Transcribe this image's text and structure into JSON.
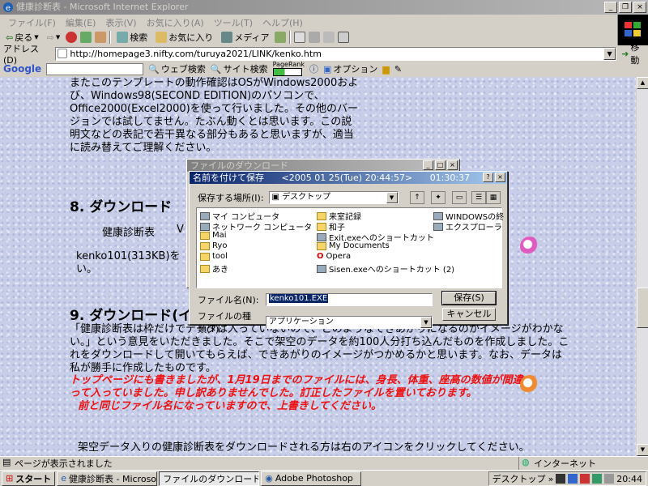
{
  "window": {
    "title": "健康診断表 - Microsoft Internet Explorer",
    "minimize": "_",
    "restore": "❐",
    "close": "×"
  },
  "menu": [
    "ファイル(F)",
    "編集(E)",
    "表示(V)",
    "お気に入り(A)",
    "ツール(T)",
    "ヘルプ(H)"
  ],
  "toolbar": {
    "back": "戻る",
    "search": "検索",
    "favorites": "お気に入り",
    "media": "メディア"
  },
  "address": {
    "label": "アドレス(D)",
    "url": "http://homepage3.nifty.com/turuya2021/LINK/kenko.htm",
    "go": "移動"
  },
  "google": {
    "logo": "Google",
    "web_search": "ウェブ検索",
    "site_search": "サイト検索",
    "pagerank": "PageRank",
    "options": "オプション"
  },
  "page": {
    "para1": "またこのテンプレートの動作確認はOSがWindows2000および、Windows98(SECOND EDITION)のパソコンで、Office2000(Excel2000)を使って行いました。その他のバージョンでは試してません。たぶん動くとは思います。この説明文などの表記で若干異なる部分もあると思いますが、適当に読み替えてご理解ください。",
    "heading8": "8. ダウンロード",
    "kenko_label": "健康診断表",
    "kenko_v": "V",
    "kenko_file": "kenko101(313KB)を",
    "kenko_file_tail": "い。",
    "heading9": "9. ダウンロード(イ",
    "para2": "「健康診断表は枠だけでデータは入っていないので、どのようなできあがりになるのかイメージがわかない。」という意見をいただきました。そこで架空のデータを約100人分打ち込んだものを作成しました。これをダウンロードして開いてもらえば、できあがりのイメージがつかめるかと思います。なお、データは私が勝手に作成したものです。",
    "red_note": "トップページにも書きましたが、1月19日までのファイルには、身長、体重、座高の数値が間違って入っていました。申し訳ありませんでした。訂正したファイルを置いております。",
    "red_note2": "前と同じファイル名になっていますので、上書きしてください。",
    "para3": "架空データ入りの健康診断表をダウンロードされる方は右のアイコンをクリックしてください。"
  },
  "download_dialog": {
    "title": "ファイルのダウンロード"
  },
  "save_dialog": {
    "title": "名前を付けて保存",
    "timestamp": "<2005 01 25(Tue) 20:44:57>",
    "elapsed": "01:30:37",
    "help": "?",
    "close": "×",
    "location_label": "保存する場所(I):",
    "location_value": "デスクトップ",
    "files": [
      {
        "name": "マイ コンピュータ",
        "kind": "sc"
      },
      {
        "name": "ネットワーク コンピュータ",
        "kind": "sc"
      },
      {
        "name": "Mai",
        "kind": "fld"
      },
      {
        "name": "Ryo",
        "kind": "fld"
      },
      {
        "name": "tool",
        "kind": "fld"
      },
      {
        "name": "あき",
        "kind": "fld"
      },
      {
        "name": "来室記録",
        "kind": "fld"
      },
      {
        "name": "和子",
        "kind": "fld"
      },
      {
        "name": "Exit.exeへのショートカット",
        "kind": "sc"
      },
      {
        "name": "My Documents",
        "kind": "fld"
      },
      {
        "name": "Opera",
        "kind": "sc"
      },
      {
        "name": "Sisen.exeへのショートカット (2)",
        "kind": "sc"
      },
      {
        "name": "WINDOWSの終",
        "kind": "sc"
      },
      {
        "name": "エクスプローラ",
        "kind": "sc"
      }
    ],
    "filename_label": "ファイル名(N):",
    "filename_value": "kenko101.EXE",
    "filetype_label": "ファイルの種類(T):",
    "filetype_value": "アプリケーション",
    "save_button": "保存(S)",
    "cancel_button": "キャンセル"
  },
  "status": {
    "text": "ページが表示されました",
    "zone": "インターネット"
  },
  "taskbar": {
    "start": "スタート",
    "tasks": [
      "健康診断表 - Microsoft I...",
      "ファイルのダウンロード",
      "Adobe Photoshop"
    ],
    "desktop": "デスクトップ",
    "clock": "20:44"
  }
}
